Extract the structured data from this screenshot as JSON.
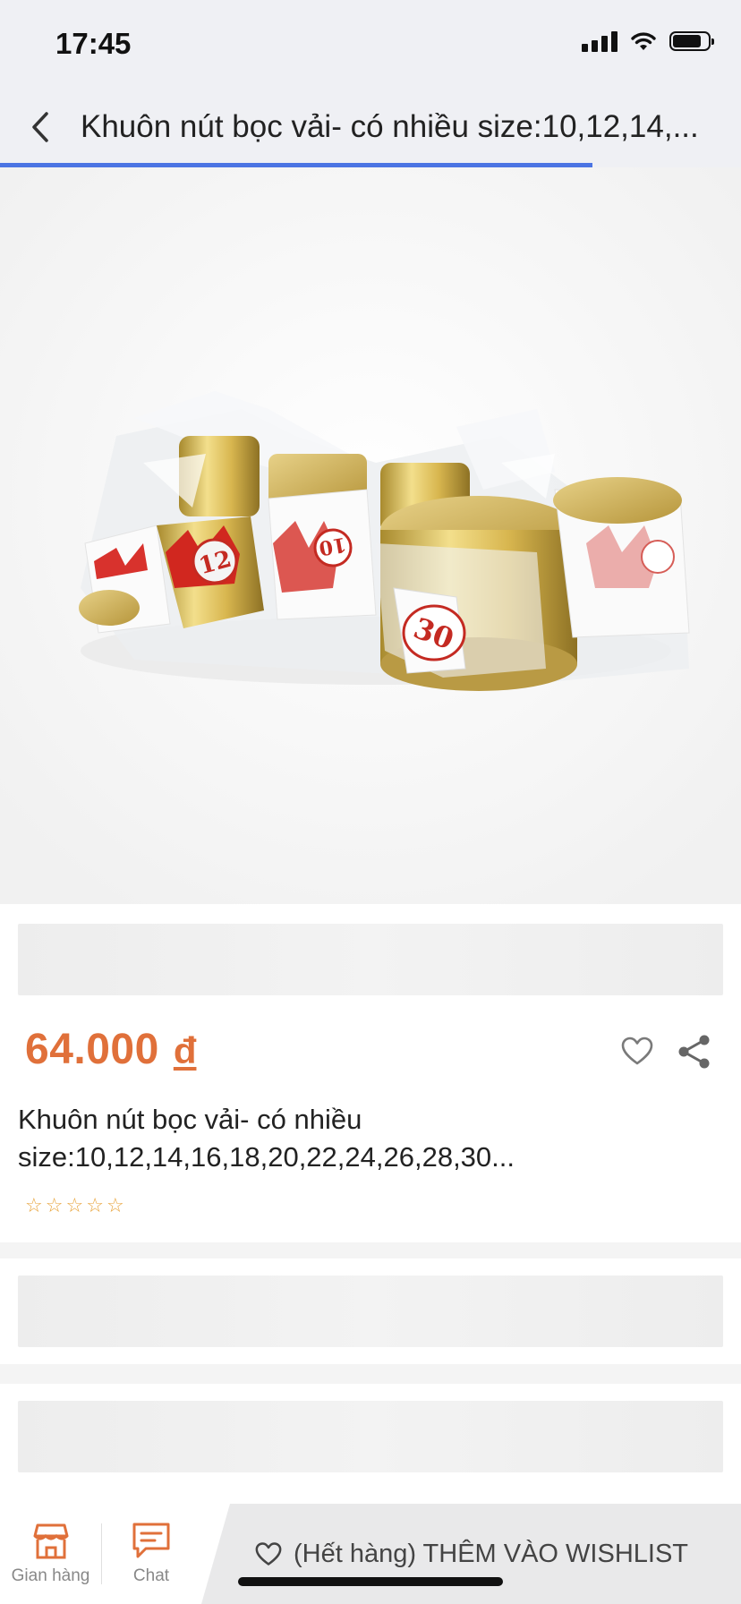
{
  "status_bar": {
    "time": "17:45"
  },
  "nav": {
    "title": "Khuôn nút bọc vải- có nhiều size:10,12,14,...",
    "load_progress": 0.8
  },
  "product": {
    "price": "64.000",
    "currency": "đ",
    "name_line1": "Khuôn nút bọc vải- có nhiều",
    "name_line2": "size:10,12,14,16,18,20,22,24,26,28,30...",
    "rating": 0,
    "rating_max": 5,
    "image_labels": {
      "left_box": "12",
      "middle_box": "10",
      "right_box": "30"
    }
  },
  "bottom_bar": {
    "store_label": "Gian hàng",
    "chat_label": "Chat",
    "wishlist_label": "(Hết hàng) THÊM VÀO WISHLIST"
  },
  "icons": [
    "back-arrow-icon",
    "heart-icon",
    "share-icon",
    "store-icon",
    "chat-icon",
    "heart-outline-icon"
  ],
  "colors": {
    "price": "#e0703a",
    "progress": "#4b74e3",
    "star": "#e8a33a"
  }
}
